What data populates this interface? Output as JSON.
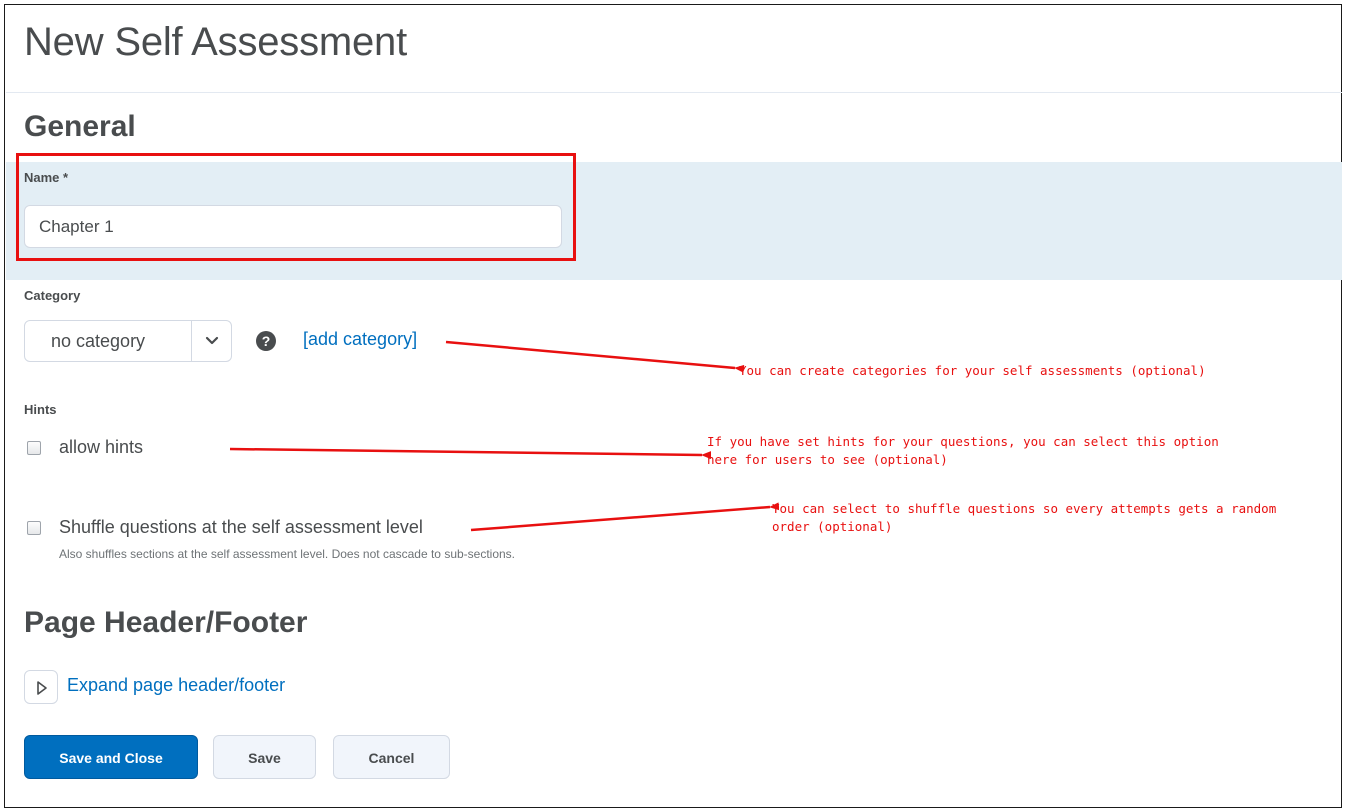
{
  "page": {
    "title": "New Self Assessment"
  },
  "general": {
    "heading": "General",
    "name": {
      "label": "Name *",
      "value": "Chapter 1"
    },
    "category": {
      "label": "Category",
      "selected": "no category",
      "add_link": "[add category]"
    },
    "hints": {
      "label": "Hints",
      "allow_hints_label": "allow hints",
      "allow_hints_checked": false
    },
    "shuffle": {
      "label": "Shuffle questions at the self assessment level",
      "description": "Also shuffles sections at the self assessment level. Does not cascade to sub-sections.",
      "checked": false
    }
  },
  "header_footer": {
    "heading": "Page Header/Footer",
    "expand_link": "Expand page header/footer"
  },
  "buttons": {
    "save_and_close": "Save and Close",
    "save": "Save",
    "cancel": "Cancel"
  },
  "annotations": {
    "category_note": "You can create categories for your self assessments (optional)",
    "hints_note_line1": "If you have set hints for your questions, you can select this option",
    "hints_note_line2": "here for users to see (optional)",
    "shuffle_note_line1": "You can select to shuffle questions so every attempts gets a random",
    "shuffle_note_line2": "order (optional)",
    "color": "#e81010"
  },
  "colors": {
    "primary": "#006fbf",
    "link": "#006fbf",
    "highlight_band": "#e3eef5",
    "text": "#494c4e"
  }
}
